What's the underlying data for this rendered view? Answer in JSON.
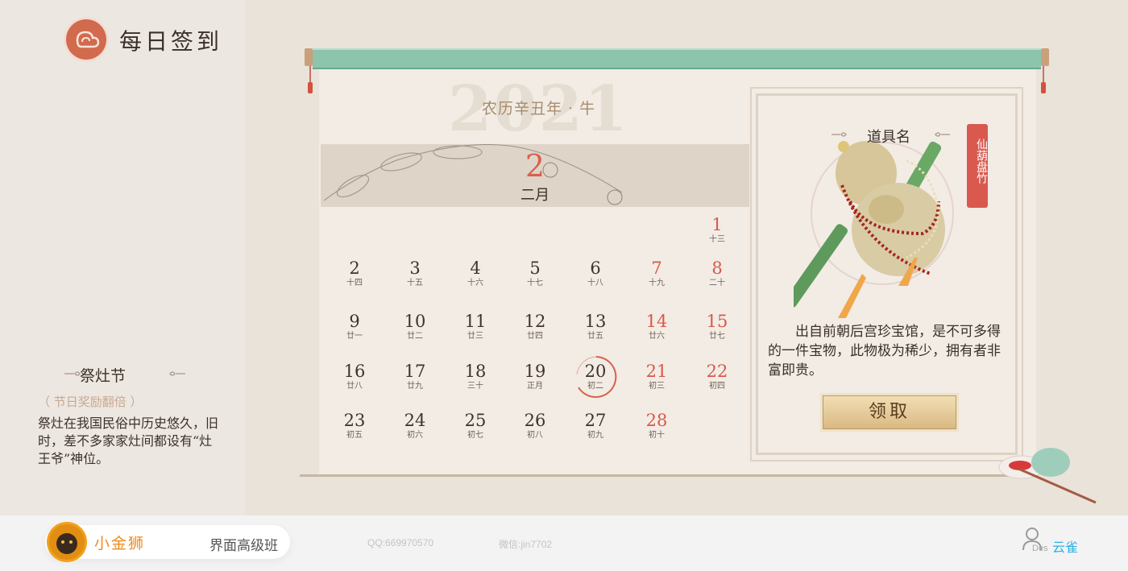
{
  "app": {
    "title": "每日签到"
  },
  "festival": {
    "title": "祭灶节",
    "reward_note": "（ 节日奖励翻倍 ）",
    "description": "祭灶在我国民俗中历史悠久，旧时，差不多家家灶间都设有“灶王爷”神位。"
  },
  "calendar": {
    "year_watermark": "2021",
    "lunar_year": "农历辛丑年 · 牛",
    "month_number": "2",
    "month_label": "二月",
    "today": 20,
    "days": [
      {
        "n": "1",
        "l": "十三",
        "red": true
      },
      {
        "n": "2",
        "l": "十四",
        "red": false
      },
      {
        "n": "3",
        "l": "十五",
        "red": false
      },
      {
        "n": "4",
        "l": "十六",
        "red": false
      },
      {
        "n": "5",
        "l": "十七",
        "red": false
      },
      {
        "n": "6",
        "l": "十八",
        "red": false
      },
      {
        "n": "7",
        "l": "十九",
        "red": true
      },
      {
        "n": "8",
        "l": "二十",
        "red": true
      },
      {
        "n": "9",
        "l": "廿一",
        "red": false
      },
      {
        "n": "10",
        "l": "廿二",
        "red": false
      },
      {
        "n": "11",
        "l": "廿三",
        "red": false
      },
      {
        "n": "12",
        "l": "廿四",
        "red": false
      },
      {
        "n": "13",
        "l": "廿五",
        "red": false
      },
      {
        "n": "14",
        "l": "廿六",
        "red": true
      },
      {
        "n": "15",
        "l": "廿七",
        "red": true
      },
      {
        "n": "16",
        "l": "廿八",
        "red": false
      },
      {
        "n": "17",
        "l": "廿九",
        "red": false
      },
      {
        "n": "18",
        "l": "三十",
        "red": false
      },
      {
        "n": "19",
        "l": "正月",
        "red": false
      },
      {
        "n": "20",
        "l": "初二",
        "red": false
      },
      {
        "n": "21",
        "l": "初三",
        "red": true
      },
      {
        "n": "22",
        "l": "初四",
        "red": true
      },
      {
        "n": "23",
        "l": "初五",
        "red": false
      },
      {
        "n": "24",
        "l": "初六",
        "red": false
      },
      {
        "n": "25",
        "l": "初七",
        "red": false
      },
      {
        "n": "26",
        "l": "初八",
        "red": false
      },
      {
        "n": "27",
        "l": "初九",
        "red": false
      },
      {
        "n": "28",
        "l": "初十",
        "red": true
      }
    ]
  },
  "item": {
    "name": "道具名",
    "tag": "仙葫盘竹",
    "description": "出自前朝后宫珍宝馆，是不可多得的一件宝物，此物极为稀少，拥有者非富即贵。",
    "claim_label": "领取"
  },
  "footer": {
    "brand": "小金狮",
    "course": "界面高级班",
    "qq": "QQ:669970570",
    "wechat": "微信:jin7702",
    "des": "Des",
    "user": "云雀"
  },
  "colors": {
    "accent_red": "#d6594a",
    "scroll_green": "#8dc4ac",
    "gold": "#d9b982"
  }
}
